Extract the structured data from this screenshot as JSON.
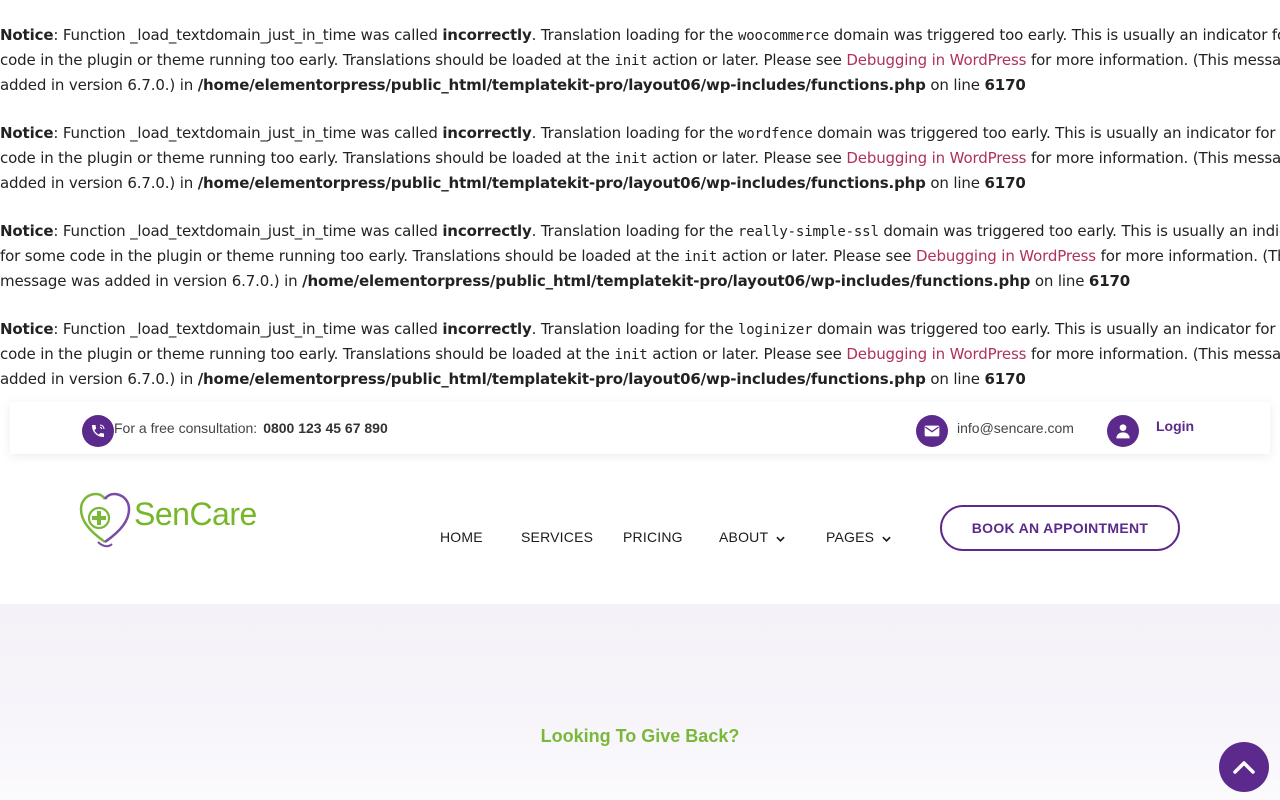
{
  "notices": [
    {
      "label": "Notice",
      "pre": ": Function _load_textdomain_just_in_time was called ",
      "strong": "incorrectly",
      "mid": ". Translation loading for the ",
      "domain": "woocommerce",
      "post1": " domain was triggered too early. This is usually an indicator for some",
      "line2a": "code in the plugin or theme running too early. Translations should be loaded at the ",
      "init": "init",
      "line2b": " action or later. Please see ",
      "link": "Debugging in WordPress",
      "line2c": " for more information. (This message was",
      "line3a": "added in version 6.7.0.) in ",
      "path": "/home/elementorpress/public_html/templatekit-pro/layout06/wp-includes/functions.php",
      "online": " on line ",
      "lineno": "6170"
    },
    {
      "label": "Notice",
      "pre": ": Function _load_textdomain_just_in_time was called ",
      "strong": "incorrectly",
      "mid": ". Translation loading for the ",
      "domain": "wordfence",
      "post1": " domain was triggered too early. This is usually an indicator for some",
      "line2a": "code in the plugin or theme running too early. Translations should be loaded at the ",
      "init": "init",
      "line2b": " action or later. Please see ",
      "link": "Debugging in WordPress",
      "line2c": " for more information. (This message was",
      "line3a": "added in version 6.7.0.) in ",
      "path": "/home/elementorpress/public_html/templatekit-pro/layout06/wp-includes/functions.php",
      "online": " on line ",
      "lineno": "6170"
    },
    {
      "label": "Notice",
      "pre": ": Function _load_textdomain_just_in_time was called ",
      "strong": "incorrectly",
      "mid": ". Translation loading for the ",
      "domain": "really-simple-ssl",
      "post1": " domain was triggered too early. This is usually an indicator",
      "line2a": "for some code in the plugin or theme running too early. Translations should be loaded at the ",
      "init": "init",
      "line2b": " action or later. Please see ",
      "link": "Debugging in WordPress",
      "line2c": " for more information. (This",
      "line3a": "message was added in version 6.7.0.) in ",
      "path": "/home/elementorpress/public_html/templatekit-pro/layout06/wp-includes/functions.php",
      "online": " on line ",
      "lineno": "6170"
    },
    {
      "label": "Notice",
      "pre": ": Function _load_textdomain_just_in_time was called ",
      "strong": "incorrectly",
      "mid": ". Translation loading for the ",
      "domain": "loginizer",
      "post1": " domain was triggered too early. This is usually an indicator for some",
      "line2a": "code in the plugin or theme running too early. Translations should be loaded at the ",
      "init": "init",
      "line2b": " action or later. Please see ",
      "link": "Debugging in WordPress",
      "line2c": " for more information. (This message was",
      "line3a": "added in version 6.7.0.) in ",
      "path": "/home/elementorpress/public_html/templatekit-pro/layout06/wp-includes/functions.php",
      "online": " on line ",
      "lineno": "6170"
    }
  ],
  "topbar": {
    "consult_label": "For a free consultation:",
    "phone": "0800 123 45 67 890",
    "email": "info@sencare.com",
    "login": "Login",
    "icons": [
      "phone-icon",
      "mail-icon",
      "user-icon"
    ]
  },
  "header": {
    "logo_text": "SenCare",
    "nav": [
      {
        "label": "HOME"
      },
      {
        "label": "SERVICES"
      },
      {
        "label": "PRICING"
      },
      {
        "label": "ABOUT"
      },
      {
        "label": "PAGES"
      }
    ],
    "book_button": "BOOK AN APPOINTMENT"
  },
  "hero": {
    "title": "Looking To Give Back?"
  },
  "colors": {
    "brand_purple": "#5c2a8c",
    "brand_green": "#76b72a",
    "link": "#b03060"
  }
}
